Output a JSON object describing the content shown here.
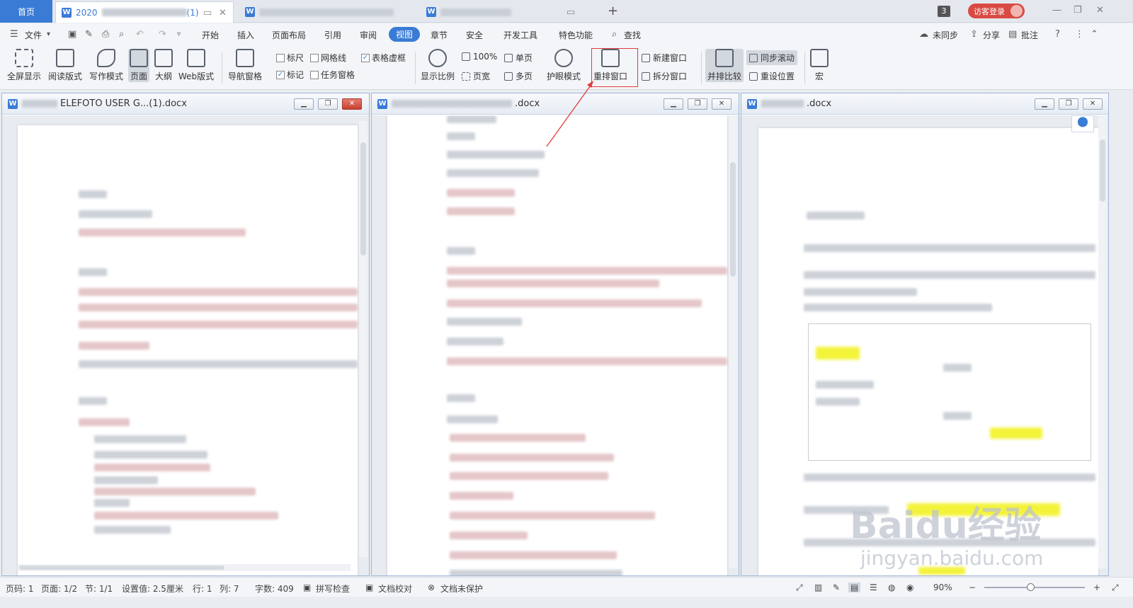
{
  "tabs": {
    "home": "首页",
    "doc1": "2020",
    "doc1_suffix": "(1)"
  },
  "menu": {
    "file": "文件",
    "items": [
      "开始",
      "插入",
      "页面布局",
      "引用",
      "审阅",
      "视图",
      "章节",
      "安全",
      "开发工具",
      "特色功能"
    ],
    "search": "查找",
    "sync": "未同步",
    "share": "分享",
    "comment": "批注"
  },
  "account": {
    "badge": "3",
    "login": "访客登录"
  },
  "ribbon": {
    "fullscreen": "全屏显示",
    "reading": "阅读版式",
    "writing": "写作模式",
    "page": "页面",
    "outline": "大纲",
    "web": "Web版式",
    "nav": "导航窗格",
    "ruler": "标尺",
    "grid": "网格线",
    "table_grid": "表格虚框",
    "mark": "标记",
    "task_pane": "任务窗格",
    "zoom_ratio": "显示比例",
    "zoom100": "100%",
    "page_width": "页宽",
    "single_page": "单页",
    "multi_page": "多页",
    "eye_mode": "护眼模式",
    "rearrange": "重排窗口",
    "new_window": "新建窗口",
    "split_window": "拆分窗口",
    "side_by_side": "并排比较",
    "sync_scroll": "同步滚动",
    "reset_pos": "重设位置",
    "macro": "宏"
  },
  "panes": [
    {
      "title": "ELEFOTO USER G...(1).docx"
    },
    {
      "title": ".docx"
    },
    {
      "title": ".docx"
    }
  ],
  "status": {
    "page_num": "页码: 1",
    "pages": "页面: 1/2",
    "section": "节: 1/1",
    "setting": "设置值: 2.5厘米",
    "row": "行: 1",
    "col": "列: 7",
    "words": "字数: 409",
    "spell": "拼写检查",
    "proof": "文档校对",
    "protect": "文档未保护",
    "zoom": "90%"
  },
  "watermark": {
    "main": "Baidu经验",
    "sub": "jingyan.baidu.com"
  }
}
